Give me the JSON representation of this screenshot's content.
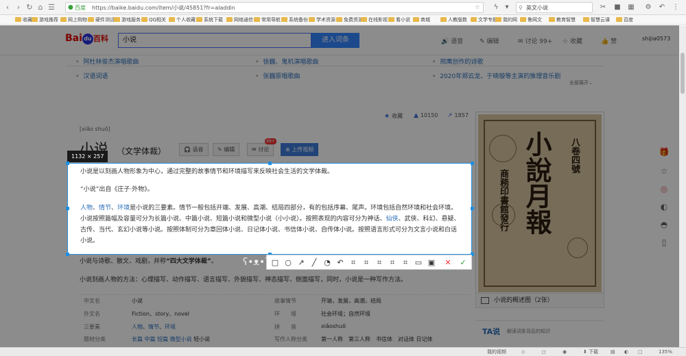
{
  "browser": {
    "secure_label": "百度",
    "url": "https://baike.baidu.com/item/小说/45851?fr=aladdin",
    "search_query": "英文小说",
    "bookmarks": [
      "收藏",
      "游戏推荐",
      "网上购物",
      "硬件测试",
      "游戏服务",
      "QQ相关",
      "个人收藏",
      "系统下载",
      "网络通信",
      "常用导航",
      "系统备份",
      "学术资源",
      "免费资源",
      "在线影视",
      "看小说",
      "商城",
      "人教版数",
      "文学专题",
      "我的网",
      "鲁网文",
      "教育智慧",
      "智慧云课",
      "百度"
    ]
  },
  "baike_header": {
    "logo_bai": "Bai",
    "logo_du": "du",
    "logo_baike": "百科",
    "search_value": "小说",
    "enter_button": "进入词条",
    "voice": "语音",
    "edit": "编辑",
    "discuss": "讨论 99+",
    "collect": "收藏",
    "like": "赞",
    "user": "shijia0573"
  },
  "related": [
    {
      "label": "阿杜林俊杰演唱歌曲"
    },
    {
      "label": "徐巍、鬼机演唱歌曲"
    },
    {
      "label": "邢鹰创作的诗歌"
    },
    {
      "label": "汉语词语"
    },
    {
      "label": "张巍原唱歌曲"
    },
    {
      "label": "2020年郑云龙、于晓璇等主演的推理音乐剧"
    }
  ],
  "expand_all": "全部展开",
  "stats": {
    "collect": "收藏",
    "likes": "10150",
    "shares": "1857"
  },
  "entry": {
    "pinyin": "[xiǎo shuō]",
    "title": "小说",
    "subtitle": "（文学体裁）",
    "voice_btn": "语音",
    "edit_btn": "编辑",
    "discuss_btn": "讨论",
    "discuss_badge": "99+",
    "upload_btn": "上传视频"
  },
  "selection": {
    "size_label": "1132 × 257",
    "p1": "小说是以刻画人物形象为中心，通过完整的故事情节和环境描写来反映社会生活的文学体裁。",
    "p2": "“小说”出自《庄子·外物》。",
    "p3_kw1": "人物",
    "p3_sep1": "、",
    "p3_kw2": "情节",
    "p3_sep2": "、",
    "p3_kw3": "环境",
    "p3_rest": "是小说的三要素。情节一般包括开端、发展、高潮、结局四部分，有的包括序幕、尾声。环境包括自然环境和社会环境。 小说按照篇幅及容量可分为长篇小说、中篇小说、短篇小说和微型小说（小小说）。按照表现的内容可分为神话、",
    "p3_kw4": "仙侠",
    "p3_rest2": "、武侠、科幻、悬疑、古传、当代、玄幻小说等小说。按照体制可分为章回体小说、日记体小说、书信体小说、自传体小说。按照语言形式可分为文言小说和白话小说。"
  },
  "body": {
    "p4_pre": "小说与诗歌、散文、戏剧，并称",
    "p4_bold": "“四大文学体裁”",
    "p4_post": "。",
    "p5": "小说刻画人物的方法：心理描写、动作描写、语言描写、外貌描写、神态描写、侧面描写，同时，小说是一种写作方法。"
  },
  "info": {
    "rows": [
      {
        "k1": "中文名",
        "v1": "小说",
        "k2": "故事情节",
        "v2": "开端，发展，高潮，结局"
      },
      {
        "k1": "外文名",
        "v1": "Fiction、story、novel",
        "k2": "环　　境",
        "v2": "社会环境；自然环境"
      },
      {
        "k1": "三要素",
        "v1a": "人物",
        "v1b": "情节",
        "v1c": "环境",
        "k2": "拼　　音",
        "v2": "xiǎoshuō"
      },
      {
        "k1": "题材分类",
        "v1a": "长篇",
        "v1b": "中篇",
        "v1c": "短篇",
        "v1d": "微型小说",
        "v1e": "轻小说",
        "k2": "写作人称分类",
        "v2": "第一人称　第三人称　书信体　对话体 日记体"
      }
    ]
  },
  "album": {
    "cover_title": "小說月報",
    "cover_side1": "八卷四號",
    "cover_side2": "商務印書館發行",
    "caption": "小说的概述图（2张）"
  },
  "ta": {
    "logo": "TA说",
    "text": "解读词条背后的知识"
  },
  "statusbar": {
    "left": "",
    "items": [
      "我的视频",
      "下载",
      "135%"
    ]
  }
}
